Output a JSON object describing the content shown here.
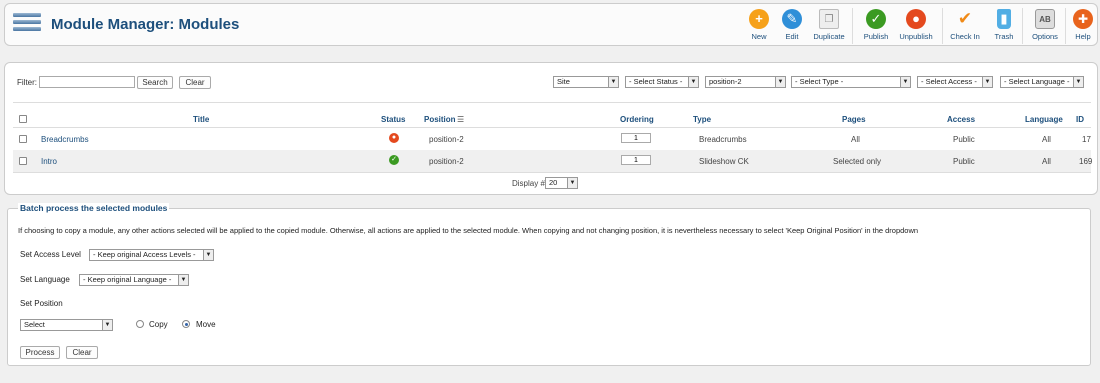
{
  "toolbar": {
    "title": "Module Manager: Modules",
    "buttons": {
      "new": "New",
      "edit": "Edit",
      "duplicate": "Duplicate",
      "publish": "Publish",
      "unpublish": "Unpublish",
      "checkin": "Check In",
      "trash": "Trash",
      "options": "Options",
      "help": "Help"
    },
    "icons": {
      "new": "plus-icon",
      "edit": "pencil-icon",
      "duplicate": "copy-icon",
      "publish": "check-icon",
      "unpublish": "circle-x-icon",
      "checkin": "checkmark-icon",
      "trash": "trash-icon",
      "options": "options-icon",
      "help": "help-lifebuoy-icon"
    }
  },
  "filter": {
    "label": "Filter:",
    "value": "",
    "search_label": "Search",
    "clear_label": "Clear",
    "client": "Site",
    "status": "- Select Status -",
    "position": "position-2",
    "type": "- Select Type -",
    "access": "- Select Access -",
    "language": "- Select Language -"
  },
  "columns": {
    "title": "Title",
    "status": "Status",
    "position": "Position",
    "ordering": "Ordering",
    "type": "Type",
    "pages": "Pages",
    "access": "Access",
    "language": "Language",
    "id": "ID"
  },
  "rows": [
    {
      "title": "Breadcrumbs",
      "status": "unpublished",
      "position": "position-2",
      "ordering": "1",
      "type": "Breadcrumbs",
      "pages": "All",
      "access": "Public",
      "language": "All",
      "id": "17"
    },
    {
      "title": "Intro",
      "status": "published",
      "position": "position-2",
      "ordering": "1",
      "type": "Slideshow CK",
      "pages": "Selected only",
      "access": "Public",
      "language": "All",
      "id": "169"
    }
  ],
  "pagination": {
    "display_label": "Display #",
    "value": "20"
  },
  "batch": {
    "legend": "Batch process the selected modules",
    "instructions": "If choosing to copy a module, any other actions selected will be applied to the copied module. Otherwise, all actions are applied to the selected module. When copying and not changing position, it is nevertheless necessary to select 'Keep Original Position' in the dropdown",
    "access_label": "Set Access Level",
    "access_value": "- Keep original Access Levels -",
    "language_label": "Set Language",
    "language_value": "- Keep original Language -",
    "position_label": "Set Position",
    "position_value": "Select",
    "copy_label": "Copy",
    "move_label": "Move",
    "process_label": "Process",
    "clear_label": "Clear"
  },
  "colors": {
    "link": "#1d4f7c",
    "new": "#f6a11a",
    "edit": "#2f8fd8",
    "publish": "#3b9a22",
    "unpublish": "#e4491e",
    "checkin": "#f08a17",
    "trash": "#52aee4",
    "help": "#e8631c"
  }
}
